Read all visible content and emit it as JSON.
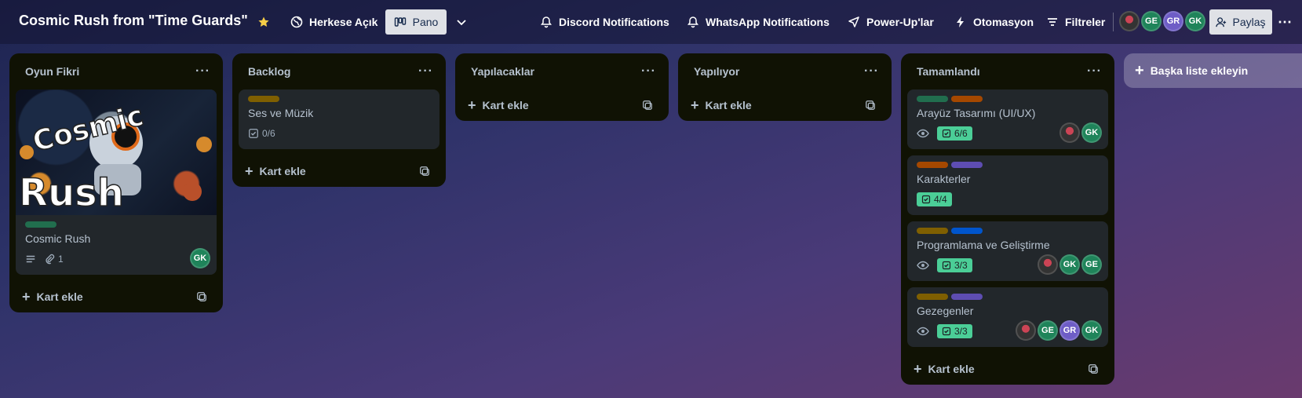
{
  "header": {
    "board_title": "Cosmic Rush from \"Time Guards\"",
    "visibility": "Herkese Açık",
    "view": "Pano",
    "discord": "Discord Notifications",
    "whatsapp": "WhatsApp Notifications",
    "powerups": "Power-Up'lar",
    "automation": "Otomasyon",
    "filters": "Filtreler",
    "share": "Paylaş",
    "avatars": [
      "GE",
      "GR",
      "GK"
    ]
  },
  "lists": [
    {
      "title": "Oyun Fikri",
      "cards": [
        {
          "title": "Cosmic Rush",
          "cover_text": [
            "Cosmic",
            "Rush"
          ],
          "labels": [
            "#216e4e"
          ],
          "attachments": "1",
          "avatars": [
            "GK"
          ]
        }
      ],
      "add_card": "Kart ekle"
    },
    {
      "title": "Backlog",
      "cards": [
        {
          "title": "Ses ve Müzik",
          "labels": [
            "#7f5f01"
          ],
          "checklist": "0/6"
        }
      ],
      "add_card": "Kart ekle"
    },
    {
      "title": "Yapılacaklar",
      "cards": [],
      "add_card": "Kart ekle"
    },
    {
      "title": "Yapılıyor",
      "cards": [],
      "add_card": "Kart ekle"
    },
    {
      "title": "Tamamlandı",
      "cards": [
        {
          "title": "Arayüz Tasarımı (UI/UX)",
          "labels": [
            "#216e4e",
            "#a54800"
          ],
          "checklist": "6/6",
          "avatars": [
            "GK"
          ]
        },
        {
          "title": "Karakterler",
          "labels": [
            "#a54800",
            "#5e4db2"
          ],
          "checklist": "4/4"
        },
        {
          "title": "Programlama ve Geliştirme",
          "labels": [
            "#7f5f01",
            "#0055cc"
          ],
          "checklist": "3/3",
          "avatars": [
            "GK",
            "GE"
          ]
        },
        {
          "title": "Gezegenler",
          "labels": [
            "#7f5f01",
            "#5e4db2"
          ],
          "checklist": "3/3",
          "avatars": [
            "GE",
            "GR",
            "GK"
          ]
        }
      ],
      "add_card": "Kart ekle"
    }
  ],
  "add_list": "Başka liste ekleyin"
}
